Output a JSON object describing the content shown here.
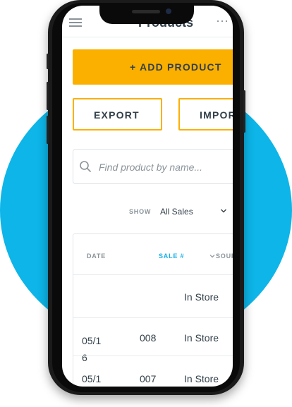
{
  "colors": {
    "background_circle": "#0db5e8",
    "accent": "#fbb000",
    "active_header": "#19b0e6",
    "text": "#33404a",
    "muted": "#8a9399"
  },
  "header": {
    "menu_icon": "hamburger-icon",
    "title": "Products",
    "more_icon": "more-dots-icon"
  },
  "actions": {
    "add_product": "+ ADD PRODUCT",
    "export": "EXPORT",
    "import": "IMPOR"
  },
  "search": {
    "icon": "search-icon",
    "placeholder": "Find product by name..."
  },
  "filter": {
    "label": "SHOW",
    "value": "All Sales",
    "icon": "chevron-down-icon"
  },
  "table": {
    "columns": [
      "DATE",
      "SALE #",
      "SOUR"
    ],
    "rows": [
      {
        "date": "",
        "sale": "",
        "source": "In Store"
      },
      {
        "date": "05/1\n6",
        "sale": "008",
        "source": "In Store"
      },
      {
        "date": "05/1",
        "sale": "007",
        "source": "In Store"
      }
    ]
  }
}
